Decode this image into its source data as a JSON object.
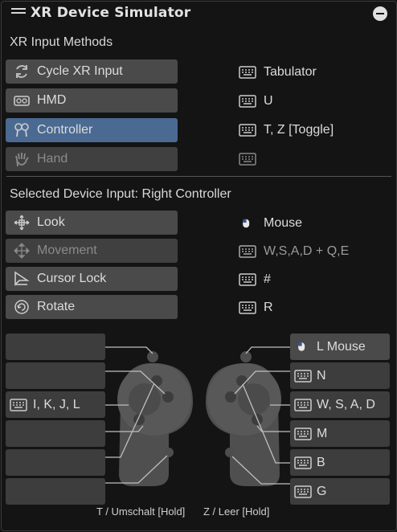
{
  "title": "XR Device Simulator",
  "input_methods": {
    "heading": "XR Input Methods",
    "buttons": [
      {
        "label": "Cycle XR Input",
        "icon": "cycle-icon",
        "state": "normal",
        "key": "Tabulator"
      },
      {
        "label": "HMD",
        "icon": "hmd-icon",
        "state": "normal",
        "key": "U"
      },
      {
        "label": "Controller",
        "icon": "controller-icon",
        "state": "selected",
        "key": "T, Z [Toggle]"
      },
      {
        "label": "Hand",
        "icon": "hand-icon",
        "state": "disabled",
        "key": ""
      }
    ]
  },
  "device_input": {
    "heading": "Selected Device Input: Right Controller",
    "buttons": [
      {
        "label": "Look",
        "icon": "look-icon",
        "state": "normal",
        "key": "Mouse",
        "key_icon": "mouse-icon"
      },
      {
        "label": "Movement",
        "icon": "movement-icon",
        "state": "disabled",
        "key": "W,S,A,D + Q,E",
        "key_icon": "keyboard-icon"
      },
      {
        "label": "Cursor Lock",
        "icon": "cursor-icon",
        "state": "normal",
        "key": "#",
        "key_icon": "keyboard-icon"
      },
      {
        "label": "Rotate",
        "icon": "rotate-icon",
        "state": "normal",
        "key": "R",
        "key_icon": "keyboard-icon"
      }
    ]
  },
  "left_controller_slots": [
    "",
    "",
    "I, K, J, L",
    "",
    "",
    ""
  ],
  "right_controller_slots": [
    "L Mouse",
    "N",
    "W, S, A, D",
    "M",
    "B",
    "G"
  ],
  "footer": {
    "left": "T / Umschalt [Hold]",
    "right": "Z / Leer [Hold]"
  },
  "colors": {
    "background": "#141414",
    "button": "#4a4a4a",
    "selected": "#4a6a92",
    "text": "#dcdcdc"
  }
}
